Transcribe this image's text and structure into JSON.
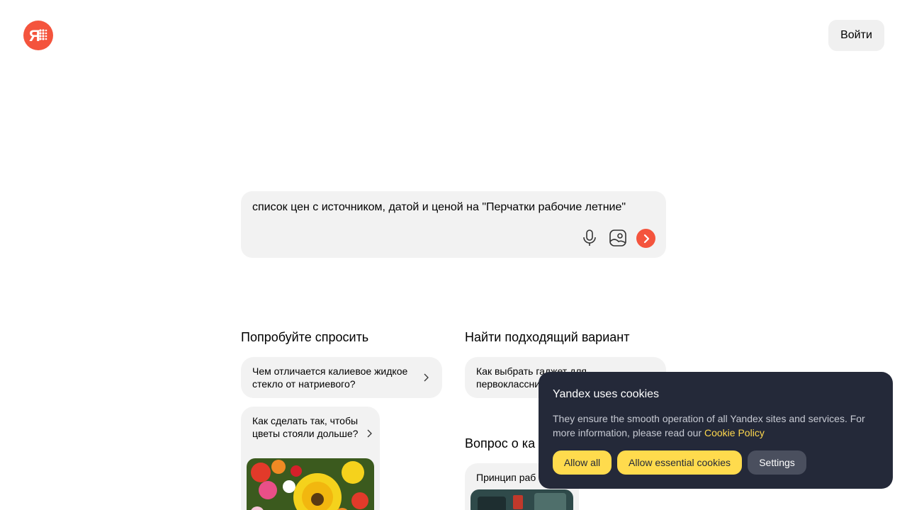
{
  "header": {
    "logo_icon": "yandex-ya-logo",
    "login_label": "Войти"
  },
  "search": {
    "query": "список цен с источником, датой и ценой на \"Перчатки рабочие летние\"",
    "icons": [
      "microphone-icon",
      "image-search-icon",
      "send-arrow-icon"
    ]
  },
  "sections": {
    "try_ask": {
      "title": "Попробуйте спросить",
      "chips": [
        "Чем отличается калиевое жидкое стекло от натриевого?",
        "Как сделать так, чтобы цветы стояли дольше?"
      ]
    },
    "find_option": {
      "title": "Найти подходящий вариант",
      "chips": [
        "Как выбрать гаджет для первоклассника"
      ]
    },
    "question": {
      "title": "Вопрос о ка",
      "chips": [
        "Принцип раб"
      ]
    }
  },
  "cookie_banner": {
    "title": "Yandex uses cookies",
    "text": "They ensure the smooth operation of all Yandex sites and services. For more information, please read our",
    "link": "Cookie Policy",
    "buttons": {
      "allow_all": "Allow all",
      "allow_essential": "Allow essential cookies",
      "settings": "Settings"
    }
  },
  "colors": {
    "brand": "#f4543d",
    "banner_bg": "#242939",
    "banner_button": "#ffdb4d",
    "chip_bg": "#f2f2f2"
  }
}
